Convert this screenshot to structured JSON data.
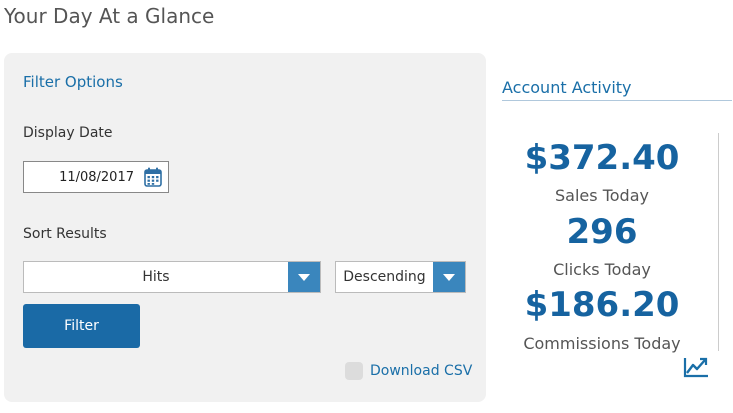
{
  "page": {
    "title": "Your Day At a Glance"
  },
  "filter": {
    "heading": "Filter Options",
    "display_date_label": "Display Date",
    "display_date_value": "11/08/2017",
    "sort_label": "Sort Results",
    "sort_field_value": "Hits",
    "sort_order_value": "Descending",
    "filter_button": "Filter",
    "download_label": "Download CSV"
  },
  "activity": {
    "heading": "Account Activity",
    "stats": [
      {
        "value": "$372.40",
        "label": "Sales Today"
      },
      {
        "value": "296",
        "label": "Clicks Today"
      },
      {
        "value": "$186.20",
        "label": "Commissions Today"
      }
    ]
  },
  "colors": {
    "accent": "#1a6fa8",
    "button": "#1a6aa6",
    "dropdown_arrow": "#3a86bd",
    "stat_value": "#1663a0"
  },
  "icons": {
    "date_picker": "calendar-icon",
    "dropdown": "chevron-down-icon",
    "chart": "trend-chart-icon"
  }
}
